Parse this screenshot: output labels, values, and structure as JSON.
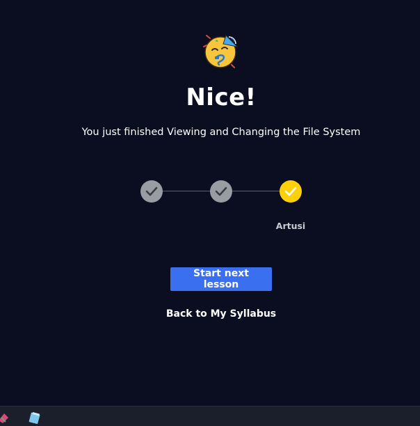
{
  "completion": {
    "emoji_icon": "partying-face-icon",
    "title": "Nice!",
    "subtitle": "You just finished Viewing and Changing the File System"
  },
  "progress": {
    "steps": [
      {
        "state": "completed",
        "label": ""
      },
      {
        "state": "completed",
        "label": ""
      },
      {
        "state": "current",
        "label": "Artusi"
      }
    ],
    "colors": {
      "completed": "#9a9ca3",
      "current": "#fcd10a",
      "line": "#5b5f70"
    }
  },
  "actions": {
    "next_label": "Start next lesson",
    "back_label": "Back to My Syllabus"
  },
  "taskbar": {
    "icons": [
      "ribbon-app-icon",
      "notepad-app-icon"
    ]
  },
  "colors": {
    "background": "#0b0e20",
    "accent": "#3a6ff0"
  }
}
